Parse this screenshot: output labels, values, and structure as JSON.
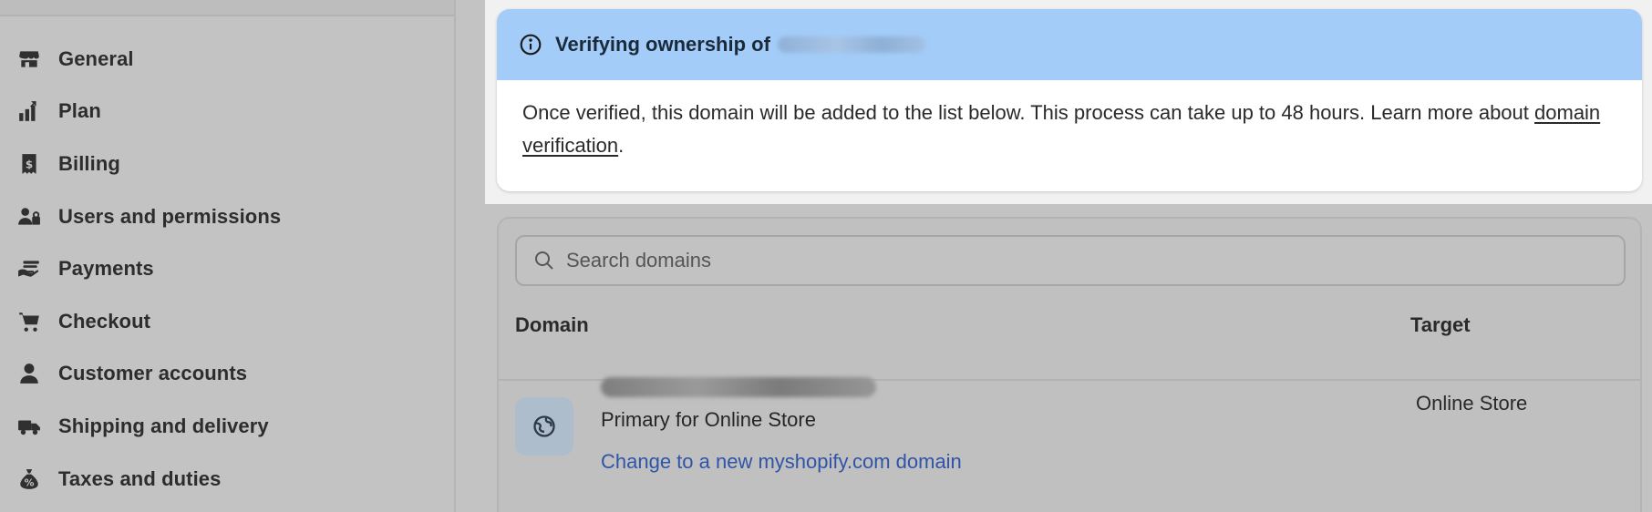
{
  "sidebar": {
    "items": [
      {
        "label": "General",
        "icon": "store-icon"
      },
      {
        "label": "Plan",
        "icon": "plan-chart-icon"
      },
      {
        "label": "Billing",
        "icon": "receipt-icon"
      },
      {
        "label": "Users and permissions",
        "icon": "users-icon"
      },
      {
        "label": "Payments",
        "icon": "payments-hand-icon"
      },
      {
        "label": "Checkout",
        "icon": "cart-icon"
      },
      {
        "label": "Customer accounts",
        "icon": "person-icon"
      },
      {
        "label": "Shipping and delivery",
        "icon": "truck-icon"
      },
      {
        "label": "Taxes and duties",
        "icon": "money-bag-icon"
      }
    ]
  },
  "banner": {
    "title": "Verifying ownership of",
    "body_text": "Once verified, this domain will be added to the list below. This process can take up to 48 hours. Learn more about ",
    "link_text": "domain verification",
    "body_end": ".",
    "header_color": "#a3cdf8"
  },
  "domains": {
    "search_placeholder": "Search domains",
    "columns": {
      "domain": "Domain",
      "target": "Target"
    },
    "rows": [
      {
        "primary_label": "Primary for Online Store",
        "change_link": "Change to a new myshopify.com domain",
        "target": "Online Store"
      }
    ],
    "link_color": "#2f54a8"
  }
}
